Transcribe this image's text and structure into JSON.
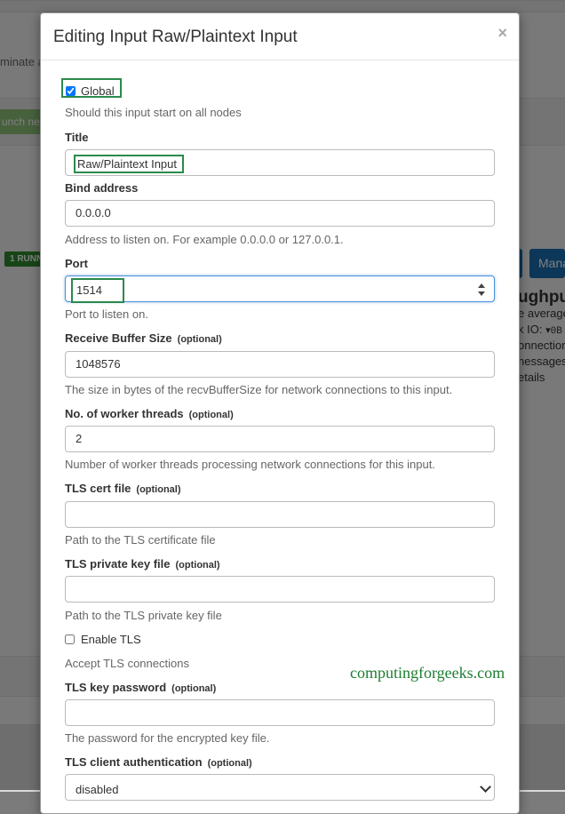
{
  "background": {
    "fragment_terminate": "minate a",
    "fragment_launch": "unch ne",
    "running_badge": "1 RUNN",
    "manage_button": "Mana",
    "fragments_right": [
      "ughput",
      "e average",
      "k IO:",
      "onnection",
      "nessages",
      "etails"
    ],
    "io_value": "▾0B"
  },
  "modal": {
    "title": "Editing Input Raw/Plaintext Input",
    "close": "×"
  },
  "form": {
    "global": {
      "label": "Global",
      "checked": true,
      "help": "Should this input start on all nodes"
    },
    "title": {
      "label": "Title",
      "value": "Raw/Plaintext Input"
    },
    "bind_address": {
      "label": "Bind address",
      "value": "0.0.0.0",
      "help": "Address to listen on. For example 0.0.0.0 or 127.0.0.1."
    },
    "port": {
      "label": "Port",
      "value": "1514",
      "help": "Port to listen on."
    },
    "recv_buffer": {
      "label": "Receive Buffer Size",
      "optional": "(optional)",
      "value": "1048576",
      "help": "The size in bytes of the recvBufferSize for network connections to this input."
    },
    "worker_threads": {
      "label": "No. of worker threads",
      "optional": "(optional)",
      "value": "2",
      "help": "Number of worker threads processing network connections for this input."
    },
    "tls_cert": {
      "label": "TLS cert file",
      "optional": "(optional)",
      "value": "",
      "help": "Path to the TLS certificate file"
    },
    "tls_key": {
      "label": "TLS private key file",
      "optional": "(optional)",
      "value": "",
      "help": "Path to the TLS private key file"
    },
    "enable_tls": {
      "label": "Enable TLS",
      "checked": false,
      "help": "Accept TLS connections"
    },
    "tls_key_password": {
      "label": "TLS key password",
      "optional": "(optional)",
      "value": "",
      "help": "The password for the encrypted key file."
    },
    "tls_client_auth": {
      "label": "TLS client authentication",
      "optional": "(optional)",
      "value": "disabled"
    }
  },
  "watermark": "computingforgeeks.com",
  "colors": {
    "highlight_box": "#2b8a4c",
    "focus_border": "#4a90d9",
    "primary_button": "#1a6fb0",
    "badge_green": "#2e8b2e"
  }
}
